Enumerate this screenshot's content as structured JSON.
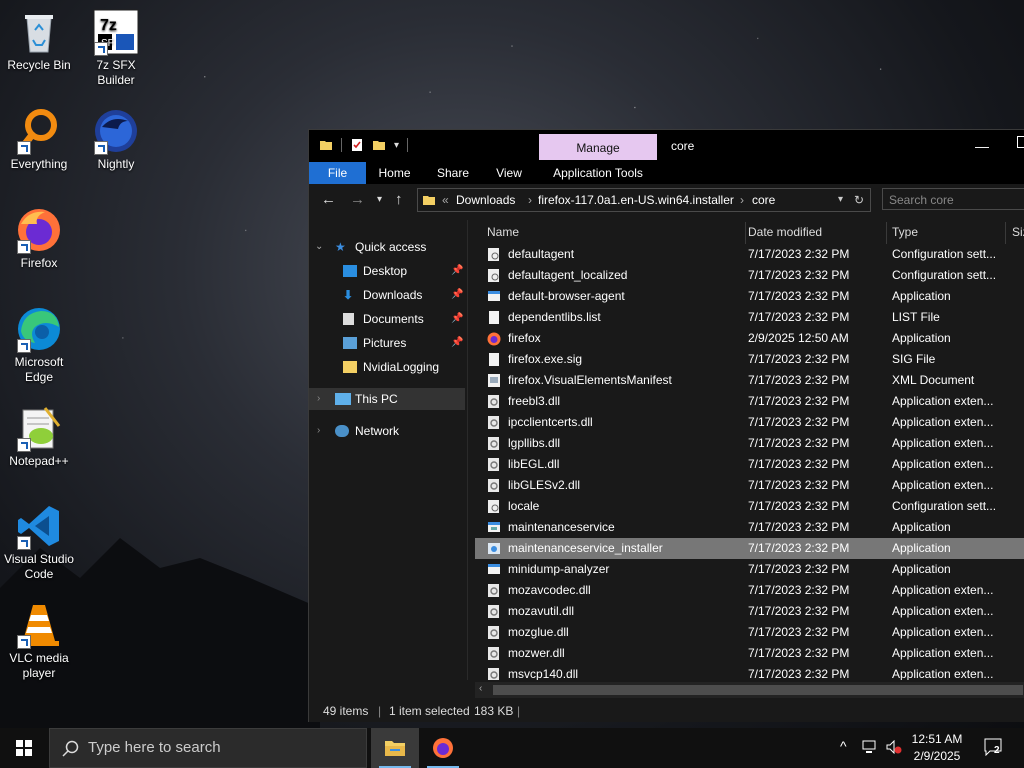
{
  "desktop": {
    "icons": [
      {
        "label": "Recycle Bin"
      },
      {
        "label": "7z SFX Builder"
      },
      {
        "label": "Everything"
      },
      {
        "label": "Nightly"
      },
      {
        "label": "Firefox"
      },
      {
        "label": "Microsoft Edge"
      },
      {
        "label": "Notepad++"
      },
      {
        "label": "Visual Studio Code"
      },
      {
        "label": "VLC media player"
      }
    ]
  },
  "window": {
    "title": "core",
    "manage_label": "Manage",
    "ribbon": {
      "file": "File",
      "home": "Home",
      "share": "Share",
      "view": "View",
      "app_tools": "Application Tools"
    },
    "address": {
      "overflow": "«",
      "crumbs": [
        "Downloads",
        "firefox-117.0a1.en-US.win64.installer",
        "core"
      ],
      "sep": "›"
    },
    "search_placeholder": "Search core",
    "nav": {
      "quick_access": "Quick access",
      "items": [
        "Desktop",
        "Downloads",
        "Documents",
        "Pictures",
        "NvidiaLogging"
      ],
      "this_pc": "This PC",
      "network": "Network"
    },
    "columns": {
      "name": "Name",
      "date": "Date modified",
      "type": "Type",
      "size": "Siz"
    },
    "files": [
      {
        "name": "defaultagent",
        "date": "7/17/2023 2:32 PM",
        "type": "Configuration sett...",
        "icon": "config-file-icon"
      },
      {
        "name": "defaultagent_localized",
        "date": "7/17/2023 2:32 PM",
        "type": "Configuration sett...",
        "icon": "config-file-icon"
      },
      {
        "name": "default-browser-agent",
        "date": "7/17/2023 2:32 PM",
        "type": "Application",
        "icon": "application-icon"
      },
      {
        "name": "dependentlibs.list",
        "date": "7/17/2023 2:32 PM",
        "type": "LIST File",
        "icon": "blank-file-icon"
      },
      {
        "name": "firefox",
        "date": "2/9/2025 12:50 AM",
        "type": "Application",
        "icon": "firefox-icon"
      },
      {
        "name": "firefox.exe.sig",
        "date": "7/17/2023 2:32 PM",
        "type": "SIG File",
        "icon": "blank-file-icon"
      },
      {
        "name": "firefox.VisualElementsManifest",
        "date": "7/17/2023 2:32 PM",
        "type": "XML Document",
        "icon": "xml-file-icon"
      },
      {
        "name": "freebl3.dll",
        "date": "7/17/2023 2:32 PM",
        "type": "Application exten...",
        "icon": "dll-file-icon"
      },
      {
        "name": "ipcclientcerts.dll",
        "date": "7/17/2023 2:32 PM",
        "type": "Application exten...",
        "icon": "dll-file-icon"
      },
      {
        "name": "lgpllibs.dll",
        "date": "7/17/2023 2:32 PM",
        "type": "Application exten...",
        "icon": "dll-file-icon"
      },
      {
        "name": "libEGL.dll",
        "date": "7/17/2023 2:32 PM",
        "type": "Application exten...",
        "icon": "dll-file-icon"
      },
      {
        "name": "libGLESv2.dll",
        "date": "7/17/2023 2:32 PM",
        "type": "Application exten...",
        "icon": "dll-file-icon"
      },
      {
        "name": "locale",
        "date": "7/17/2023 2:32 PM",
        "type": "Configuration sett...",
        "icon": "config-file-icon"
      },
      {
        "name": "maintenanceservice",
        "date": "7/17/2023 2:32 PM",
        "type": "Application",
        "icon": "maintenance-service-icon"
      },
      {
        "name": "maintenanceservice_installer",
        "date": "7/17/2023 2:32 PM",
        "type": "Application",
        "icon": "installer-icon",
        "selected": true
      },
      {
        "name": "minidump-analyzer",
        "date": "7/17/2023 2:32 PM",
        "type": "Application",
        "icon": "application-icon"
      },
      {
        "name": "mozavcodec.dll",
        "date": "7/17/2023 2:32 PM",
        "type": "Application exten...",
        "icon": "dll-file-icon"
      },
      {
        "name": "mozavutil.dll",
        "date": "7/17/2023 2:32 PM",
        "type": "Application exten...",
        "icon": "dll-file-icon"
      },
      {
        "name": "mozglue.dll",
        "date": "7/17/2023 2:32 PM",
        "type": "Application exten...",
        "icon": "dll-file-icon"
      },
      {
        "name": "mozwer.dll",
        "date": "7/17/2023 2:32 PM",
        "type": "Application exten...",
        "icon": "dll-file-icon"
      },
      {
        "name": "msvcp140.dll",
        "date": "7/17/2023 2:32 PM",
        "type": "Application exten...",
        "icon": "dll-file-icon"
      }
    ],
    "status": {
      "items": "49 items",
      "selected": "1 item selected",
      "size": "183 KB"
    }
  },
  "taskbar": {
    "search_placeholder": "Type here to search",
    "time": "12:51 AM",
    "date": "2/9/2025",
    "notification_count": "2"
  },
  "colors": {
    "accent": "#1f6fd3",
    "manage_tab": "#e6c8f0",
    "window_bg": "#191919",
    "selected_row": "#777777"
  }
}
